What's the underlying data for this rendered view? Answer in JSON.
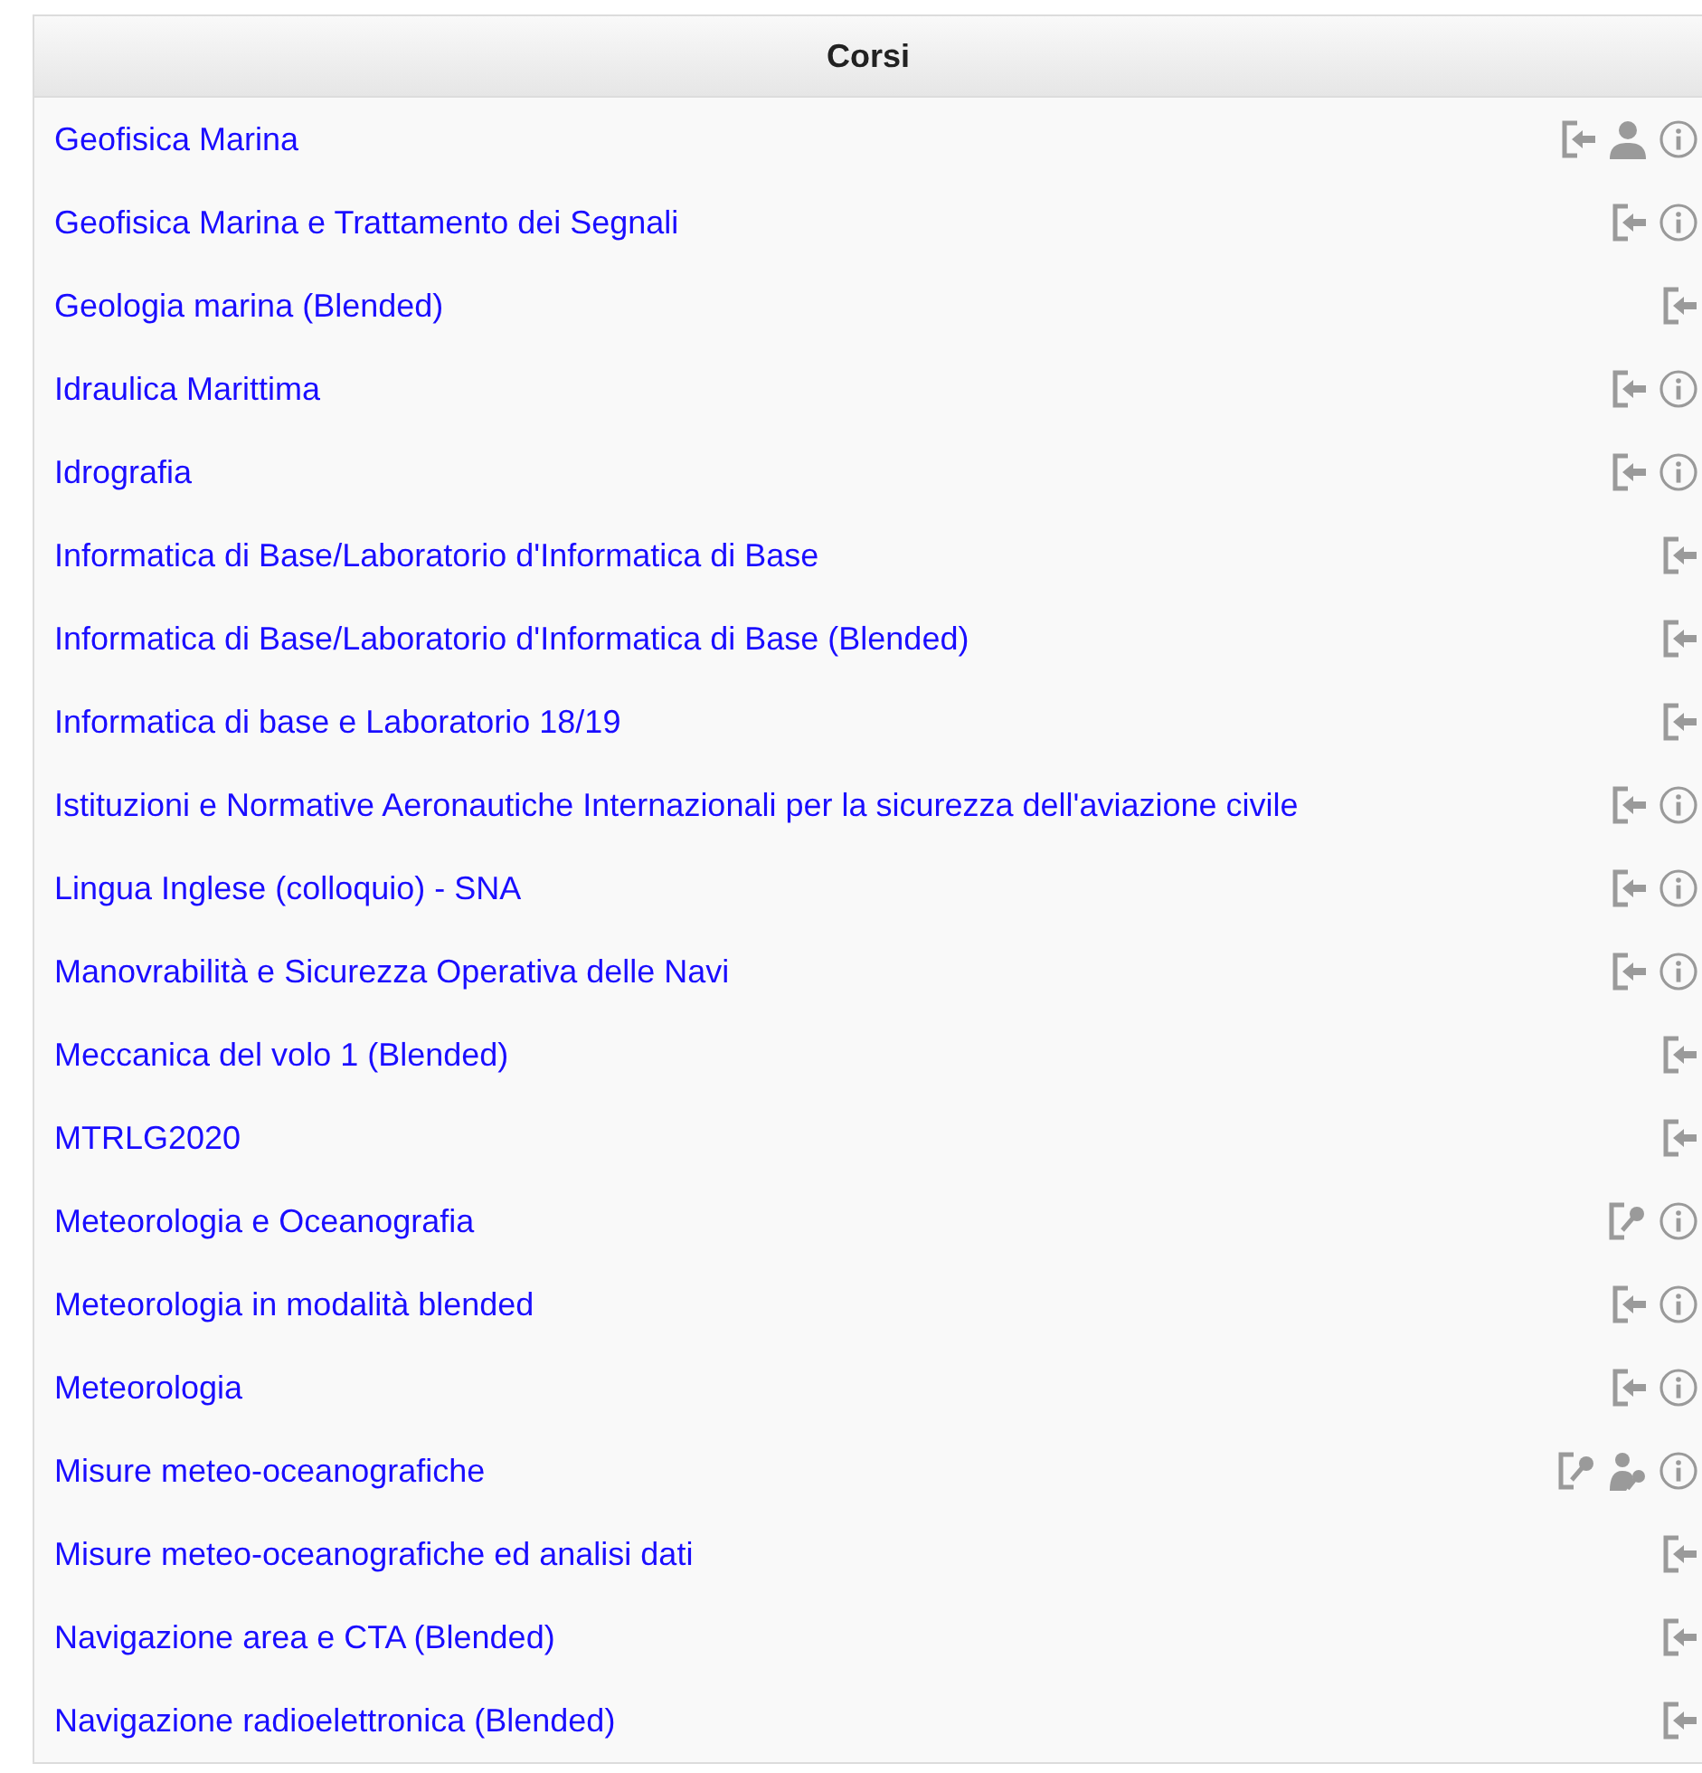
{
  "table": {
    "heading": "Corsi",
    "rows": [
      {
        "name": "Geofisica Marina",
        "icons": [
          {
            "kind": "enrol"
          },
          {
            "kind": "guest"
          },
          {
            "kind": "info"
          }
        ]
      },
      {
        "name": "Geofisica Marina e Trattamento dei Segnali",
        "icons": [
          {
            "kind": "enrol"
          },
          {
            "kind": "info"
          }
        ]
      },
      {
        "name": "Geologia marina (Blended)",
        "icons": [
          {
            "kind": "enrol"
          }
        ]
      },
      {
        "name": "Idraulica Marittima",
        "icons": [
          {
            "kind": "enrol"
          },
          {
            "kind": "info"
          }
        ]
      },
      {
        "name": "Idrografia",
        "icons": [
          {
            "kind": "enrol"
          },
          {
            "kind": "info"
          }
        ]
      },
      {
        "name": "Informatica di Base/Laboratorio d'Informatica di Base",
        "icons": [
          {
            "kind": "enrol"
          }
        ]
      },
      {
        "name": "Informatica di Base/Laboratorio d'Informatica di Base (Blended)",
        "icons": [
          {
            "kind": "enrol"
          }
        ]
      },
      {
        "name": "Informatica di base e Laboratorio 18/19",
        "icons": [
          {
            "kind": "enrol"
          }
        ]
      },
      {
        "name": "Istituzioni e Normative Aeronautiche Internazionali per la sicurezza dell'aviazione civile",
        "icons": [
          {
            "kind": "enrol"
          },
          {
            "kind": "info"
          }
        ]
      },
      {
        "name": "Lingua Inglese (colloquio) - SNA",
        "icons": [
          {
            "kind": "enrol"
          },
          {
            "kind": "info"
          }
        ]
      },
      {
        "name": "Manovrabilità e Sicurezza Operativa delle Navi",
        "icons": [
          {
            "kind": "enrol"
          },
          {
            "kind": "info"
          }
        ]
      },
      {
        "name": "Meccanica del volo 1 (Blended)",
        "icons": [
          {
            "kind": "enrol"
          }
        ]
      },
      {
        "name": "MTRLG2020",
        "icons": [
          {
            "kind": "enrol"
          }
        ]
      },
      {
        "name": "Meteorologia e Oceanografia",
        "icons": [
          {
            "kind": "key"
          },
          {
            "kind": "info"
          }
        ]
      },
      {
        "name": "Meteorologia in modalità blended",
        "icons": [
          {
            "kind": "enrol"
          },
          {
            "kind": "info"
          }
        ]
      },
      {
        "name": "Meteorologia",
        "icons": [
          {
            "kind": "enrol"
          },
          {
            "kind": "info"
          }
        ]
      },
      {
        "name": "Misure meteo-oceanografiche",
        "icons": [
          {
            "kind": "key"
          },
          {
            "kind": "guest-key"
          },
          {
            "kind": "info"
          }
        ]
      },
      {
        "name": "Misure meteo-oceanografiche ed analisi dati",
        "icons": [
          {
            "kind": "enrol"
          }
        ]
      },
      {
        "name": "Navigazione area e CTA (Blended)",
        "icons": [
          {
            "kind": "enrol"
          }
        ]
      },
      {
        "name": "Navigazione radioelettronica (Blended)",
        "icons": [
          {
            "kind": "enrol"
          }
        ]
      }
    ]
  }
}
